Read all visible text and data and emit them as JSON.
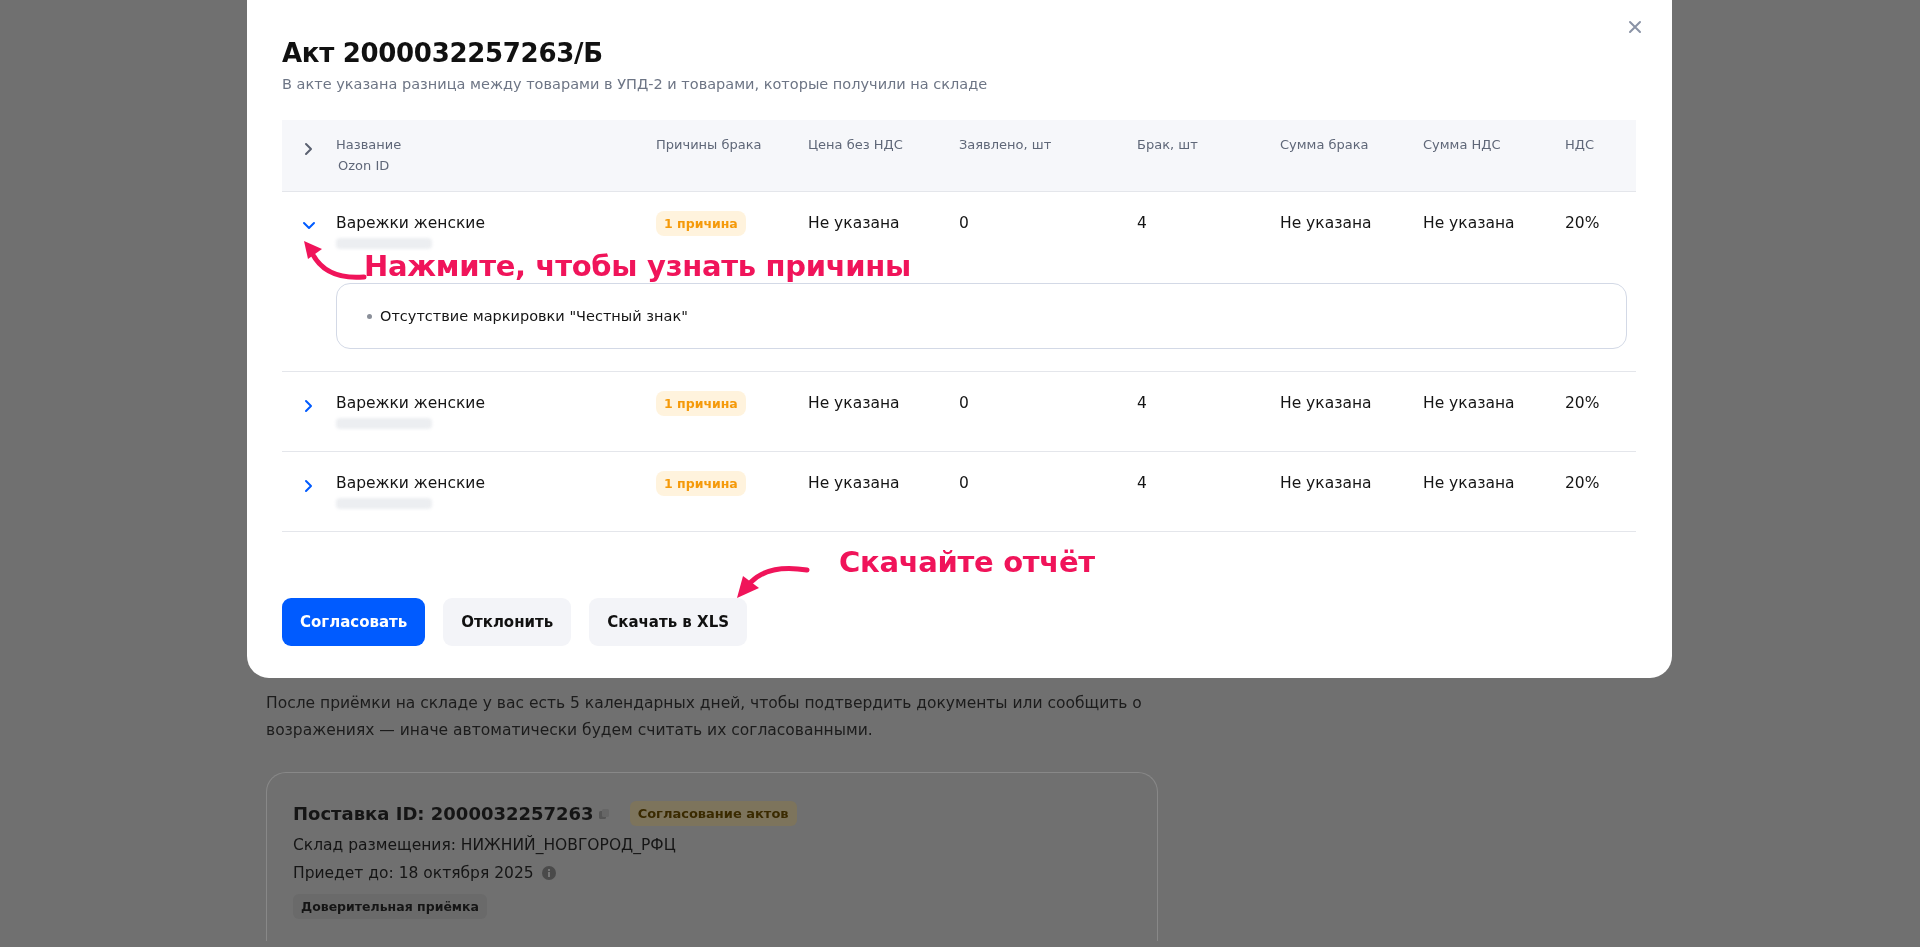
{
  "page": {
    "notice": "После приёмки на складе у вас есть 5 календарных дней, чтобы подтвердить документы или сообщить о возражениях — иначе автоматически будем считать их согласованными.",
    "supply_card": {
      "title": "Поставка ID: 2000032257263",
      "status": "Согласование актов",
      "warehouse": "Склад размещения: НИЖНИЙ_НОВГОРОД_РФЦ",
      "arrival": "Приедет до: 18 октября 2025",
      "tag": "Доверительная приёмка"
    }
  },
  "dialog": {
    "title": "Акт 2000032257263/Б",
    "subtitle": "В акте указана разница между товарами в УПД-2 и товарами, которые получили на складе",
    "table": {
      "expanded": false,
      "columns": [
        {
          "label": "Название",
          "sublabel": "Ozon ID"
        },
        {
          "label": "Причины брака"
        },
        {
          "label": "Цена без НДС"
        },
        {
          "label": "Заявлено, шт"
        },
        {
          "label": "Брак, шт"
        },
        {
          "label": "Сумма брака"
        },
        {
          "label": "Сумма НДС"
        },
        {
          "label": "НДС"
        }
      ],
      "rows": [
        {
          "expanded": true,
          "cells": [
            "Варежки женские",
            "1 причина",
            "Не указана",
            "0",
            "4",
            "Не указана",
            "Не указана",
            "20%"
          ],
          "reasons": [
            "Отсутствие маркировки \"Честный знак\""
          ]
        },
        {
          "expanded": false,
          "cells": [
            "Варежки женские",
            "1 причина",
            "Не указана",
            "0",
            "4",
            "Не указана",
            "Не указана",
            "20%"
          ]
        },
        {
          "expanded": false,
          "cells": [
            "Варежки женские",
            "1 причина",
            "Не указана",
            "0",
            "4",
            "Не указана",
            "Не указана",
            "20%"
          ]
        }
      ]
    },
    "buttons": [
      {
        "label": "Согласовать",
        "kind": "primary"
      },
      {
        "label": "Отклонить",
        "kind": "secondary"
      },
      {
        "label": "Скачать в XLS",
        "kind": "secondary"
      }
    ],
    "annotations": [
      {
        "text": "Нажмите, чтобы узнать причины",
        "kind": "row-hint"
      },
      {
        "text": "Скачайте отчёт",
        "kind": "download-hint"
      }
    ]
  }
}
